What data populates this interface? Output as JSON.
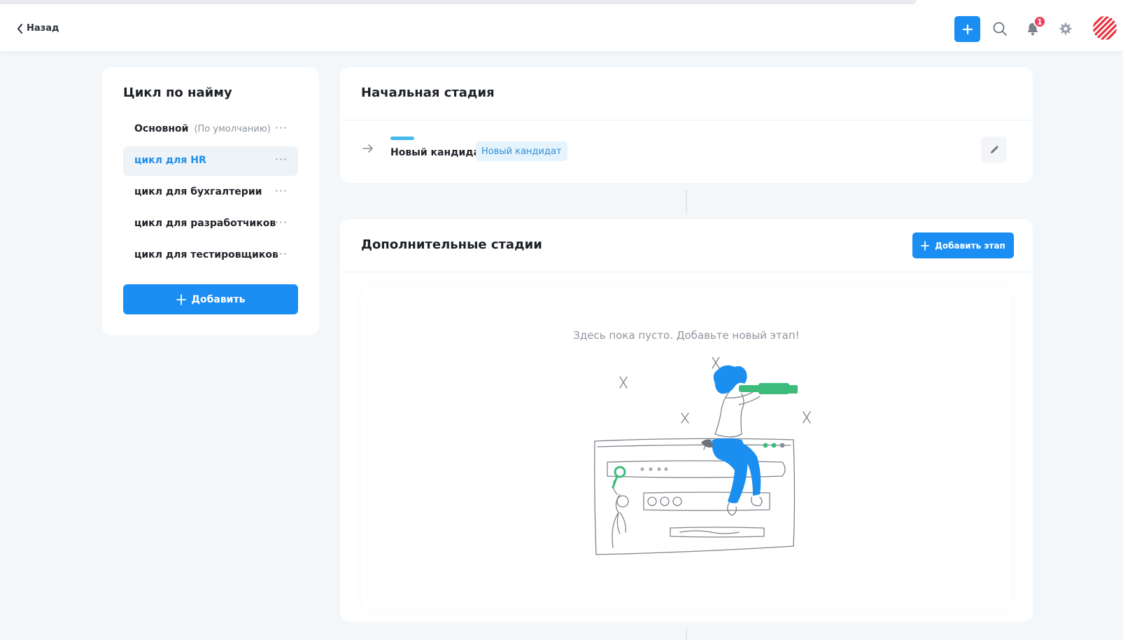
{
  "header": {
    "back_label": "Назад",
    "notifications_count": "1"
  },
  "sidebar": {
    "title": "Цикл по найму",
    "items": [
      {
        "label": "Основной",
        "note": "(По умолчанию)",
        "active": false
      },
      {
        "label": "цикл для HR",
        "note": "",
        "active": true
      },
      {
        "label": "цикл для бухгалтерии",
        "note": "",
        "active": false
      },
      {
        "label": "цикл для разработчиков",
        "note": "",
        "active": false
      },
      {
        "label": "цикл для тестировщиков",
        "note": "",
        "active": false
      }
    ],
    "more_label": "···",
    "add_button": "Добавить"
  },
  "initial_stage": {
    "title": "Начальная стадия",
    "stage_name": "Новый кандидат",
    "stage_tag": "Новый кандидат",
    "stage_color": "#45b8ee"
  },
  "extra_stages": {
    "title": "Дополнительные стадии",
    "add_button": "Добавить этап",
    "empty_text": "Здесь пока пусто. Добавьте новый этап!"
  },
  "colors": {
    "accent": "#1a8ef2",
    "badge": "#ef3b5c",
    "active_text": "#1f90ee",
    "illustration_blue": "#1b8ff0",
    "illustration_green": "#3dbb7b"
  }
}
